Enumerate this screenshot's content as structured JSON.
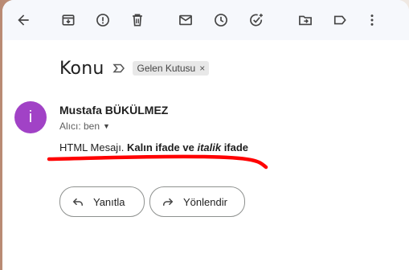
{
  "toolbar": {
    "back": "arrow-left-icon",
    "archive": "archive-icon",
    "report": "report-spam-icon",
    "delete": "trash-icon",
    "mark_unread": "mail-icon",
    "snooze": "clock-icon",
    "add_task": "add-task-icon",
    "move_to": "move-folder-icon",
    "labels": "label-icon",
    "more": "more-vert-icon"
  },
  "message": {
    "subject": "Konu",
    "label_chip": "Gelen Kutusu",
    "chip_close": "×",
    "avatar_letter": "i",
    "sender": "Mustafa BÜKÜLMEZ",
    "recipient": "Alıcı: ben",
    "body": {
      "plain": "HTML Mesajı. ",
      "bold_start": "Kalın ifade ve ",
      "bold_italic": "italik",
      "bold_end": " ifade"
    }
  },
  "actions": {
    "reply": "Yanıtla",
    "forward": "Yönlendir"
  },
  "colors": {
    "avatar": "#a142c6",
    "highlight_mark": "#ff0000",
    "toolbar_bg": "#f6f8fc"
  }
}
